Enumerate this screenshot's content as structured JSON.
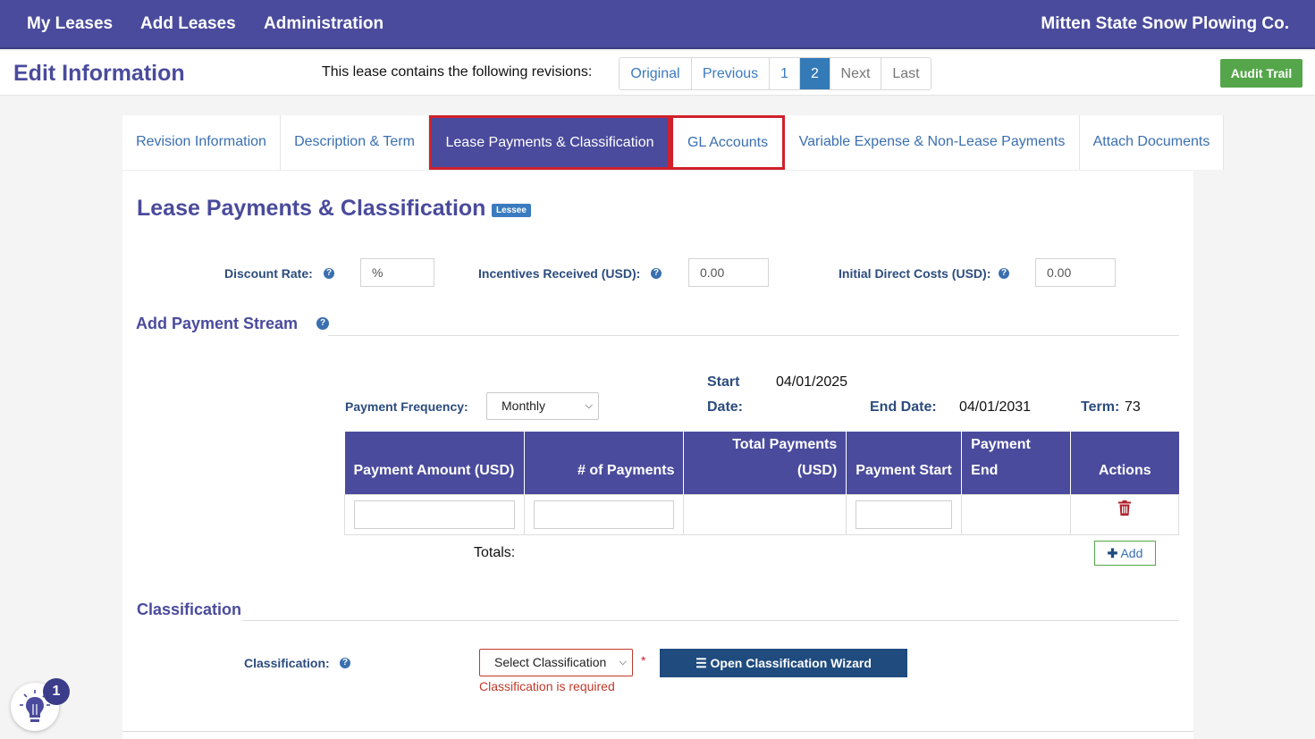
{
  "topnav": {
    "items": [
      "My Leases",
      "Add Leases",
      "Administration"
    ],
    "company": "Mitten State Snow Plowing Co."
  },
  "header": {
    "title": "Edit Information",
    "revisions_text": "This lease contains the following revisions:",
    "pager": [
      "Original",
      "Previous",
      "1",
      "2",
      "Next",
      "Last"
    ],
    "pager_active": "2",
    "audit_label": "Audit Trail"
  },
  "tabs": [
    "Revision Information",
    "Description & Term",
    "Lease Payments & Classification",
    "GL Accounts",
    "Variable Expense & Non-Lease Payments",
    "Attach Documents"
  ],
  "section": {
    "title": "Lease Payments & Classification",
    "badge": "Lessee"
  },
  "rates": {
    "discount_label": "Discount Rate:",
    "discount_placeholder": "%",
    "incentives_label": "Incentives Received (USD):",
    "incentives_placeholder": "0.00",
    "idc_label": "Initial Direct Costs (USD):",
    "idc_placeholder": "0.00"
  },
  "payment_stream": {
    "title": "Add Payment Stream",
    "frequency_label": "Payment Frequency:",
    "frequency_value": "Monthly",
    "start_label_1": "Start",
    "start_label_2": "Date:",
    "start_value": "04/01/2025",
    "end_label": "End Date:",
    "end_value": "04/01/2031",
    "term_label": "Term:",
    "term_value": "73",
    "columns": [
      "Payment Amount (USD)",
      "# of Payments",
      "Total Payments (USD)",
      "Payment Start",
      "Payment End",
      "Actions"
    ],
    "totals_label": "Totals:",
    "add_label": "Add"
  },
  "classification": {
    "title": "Classification",
    "label": "Classification:",
    "select_value": "Select Classification",
    "error": "Classification is required",
    "wizard_label": "Open Classification Wizard"
  },
  "help_widget": {
    "count": "1"
  },
  "colors": {
    "brand": "#4a4b9c",
    "audit": "#55a64a",
    "link": "#3a6fb0",
    "error": "#c0392b"
  }
}
